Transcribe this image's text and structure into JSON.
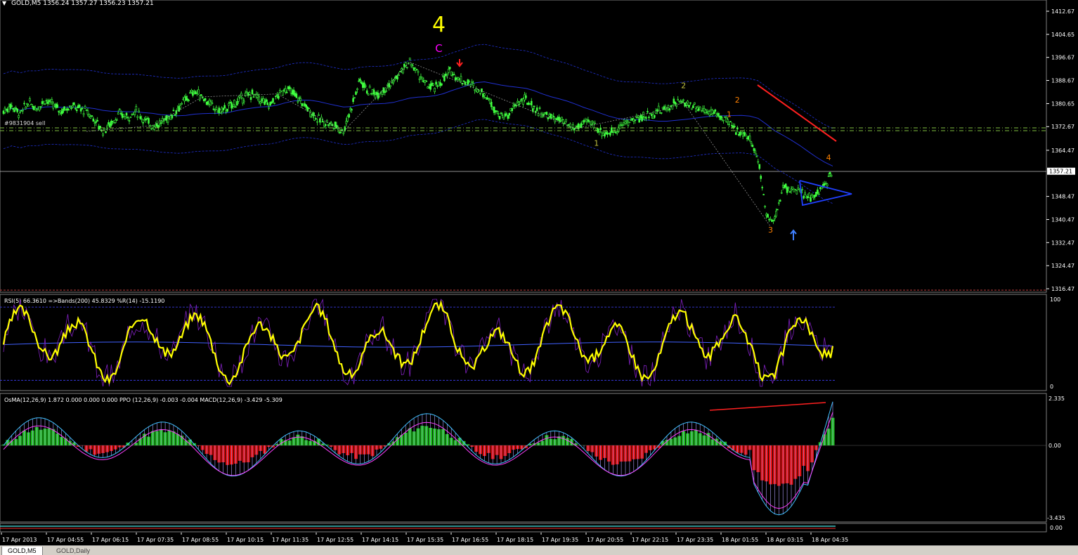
{
  "chart_data": {
    "type": "line",
    "symbol": "GOLD,M5",
    "header": "GOLD,M5  1356.24 1357.27 1356.23 1357.21",
    "price_axis": {
      "ticks": [
        "1412.67",
        "1404.65",
        "1396.67",
        "1388.67",
        "1380.65",
        "1372.67",
        "1364.47",
        "1348.47",
        "1340.47",
        "1332.47",
        "1324.47",
        "1316.47"
      ],
      "current": "1357.21"
    },
    "time_axis": [
      "17 Apr 2013",
      "17 Apr 04:55",
      "17 Apr 06:15",
      "17 Apr 07:35",
      "17 Apr 08:55",
      "17 Apr 10:15",
      "17 Apr 11:35",
      "17 Apr 12:55",
      "17 Apr 14:15",
      "17 Apr 15:35",
      "17 Apr 16:55",
      "17 Apr 18:15",
      "17 Apr 19:35",
      "17 Apr 20:55",
      "17 Apr 22:15",
      "17 Apr 23:35",
      "18 Apr 01:55",
      "18 Apr 03:15",
      "18 Apr 04:35"
    ],
    "close_path": [
      [
        0,
        1378
      ],
      [
        2,
        1380
      ],
      [
        4,
        1377
      ],
      [
        6,
        1381
      ],
      [
        8,
        1379
      ],
      [
        10,
        1382
      ],
      [
        12,
        1380
      ],
      [
        14,
        1378
      ],
      [
        16,
        1380
      ],
      [
        18,
        1379
      ],
      [
        20,
        1378
      ],
      [
        22,
        1375
      ],
      [
        24,
        1371
      ],
      [
        26,
        1374
      ],
      [
        28,
        1377
      ],
      [
        30,
        1376
      ],
      [
        32,
        1378
      ],
      [
        34,
        1375
      ],
      [
        36,
        1373
      ],
      [
        38,
        1374
      ],
      [
        40,
        1376
      ],
      [
        42,
        1379
      ],
      [
        44,
        1382
      ],
      [
        46,
        1385
      ],
      [
        48,
        1383
      ],
      [
        50,
        1380
      ],
      [
        52,
        1378
      ],
      [
        54,
        1379
      ],
      [
        56,
        1381
      ],
      [
        58,
        1383
      ],
      [
        60,
        1384
      ],
      [
        62,
        1382
      ],
      [
        64,
        1380
      ],
      [
        66,
        1383
      ],
      [
        68,
        1386
      ],
      [
        70,
        1384
      ],
      [
        72,
        1381
      ],
      [
        74,
        1378
      ],
      [
        76,
        1375
      ],
      [
        78,
        1374
      ],
      [
        80,
        1373
      ],
      [
        82,
        1371
      ],
      [
        84,
        1380
      ],
      [
        86,
        1389
      ],
      [
        88,
        1385
      ],
      [
        90,
        1384
      ],
      [
        92,
        1386
      ],
      [
        94,
        1388
      ],
      [
        96,
        1392
      ],
      [
        98,
        1395
      ],
      [
        100,
        1391
      ],
      [
        102,
        1387
      ],
      [
        104,
        1386
      ],
      [
        106,
        1389
      ],
      [
        108,
        1392
      ],
      [
        110,
        1389
      ],
      [
        112,
        1388
      ],
      [
        114,
        1386
      ],
      [
        116,
        1384
      ],
      [
        118,
        1380
      ],
      [
        120,
        1376
      ],
      [
        122,
        1377
      ],
      [
        124,
        1381
      ],
      [
        126,
        1382
      ],
      [
        128,
        1379
      ],
      [
        130,
        1377
      ],
      [
        132,
        1376
      ],
      [
        134,
        1375
      ],
      [
        136,
        1373
      ],
      [
        138,
        1372
      ],
      [
        140,
        1374
      ],
      [
        142,
        1374
      ],
      [
        144,
        1371
      ],
      [
        146,
        1370
      ],
      [
        148,
        1372
      ],
      [
        150,
        1374
      ],
      [
        152,
        1375
      ],
      [
        154,
        1376
      ],
      [
        156,
        1377
      ],
      [
        158,
        1378
      ],
      [
        160,
        1379
      ],
      [
        162,
        1381
      ],
      [
        164,
        1381
      ],
      [
        166,
        1380
      ],
      [
        168,
        1379
      ],
      [
        170,
        1378
      ],
      [
        172,
        1377
      ],
      [
        174,
        1375
      ],
      [
        176,
        1372
      ],
      [
        178,
        1371
      ],
      [
        180,
        1368
      ],
      [
        182,
        1362
      ],
      [
        184,
        1342
      ],
      [
        186,
        1340
      ],
      [
        188,
        1352
      ],
      [
        190,
        1351
      ],
      [
        192,
        1350
      ],
      [
        194,
        1348
      ],
      [
        196,
        1349
      ],
      [
        198,
        1352
      ],
      [
        200,
        1357
      ]
    ],
    "waves": [
      {
        "label": "4",
        "t": 105,
        "p": 1401,
        "color": "#ffff00"
      },
      {
        "label": "C",
        "t": 105,
        "p": 1398,
        "color": "#ff00ff"
      },
      {
        "label": "1",
        "t": 143,
        "p": 1366,
        "color": "#c0c040"
      },
      {
        "label": "2",
        "t": 164,
        "p": 1386,
        "color": "#c0c040"
      },
      {
        "label": "2",
        "t": 177,
        "p": 1381,
        "color": "#ff8000"
      },
      {
        "label": "1",
        "t": 175,
        "p": 1376,
        "color": "#ff8000"
      },
      {
        "label": "3",
        "t": 185,
        "p": 1336,
        "color": "#ff8000"
      },
      {
        "label": "4",
        "t": 199,
        "p": 1361,
        "color": "#ff8000"
      }
    ],
    "label_left": "#9831904  sell",
    "rsi_label": "RSI(5) 66.3610  =>Bands(200) 45.8329  %R(14) -15.1190",
    "rsi_axis": [
      "100",
      "0"
    ],
    "osma_label": "OsMA(12,26,9) 1.872 0.000 0.000 0.000  PPO (12,26,9) -0.003 -0.004  MACD(12,26,9) -3.429 -5.309",
    "osma_axis": [
      "2.335",
      "0.00",
      "-3.435"
    ],
    "bottom_axis": [
      "0.00"
    ]
  },
  "tabs": [
    {
      "label": "GOLD,M5"
    },
    {
      "label": "GOLD,Daily"
    }
  ]
}
